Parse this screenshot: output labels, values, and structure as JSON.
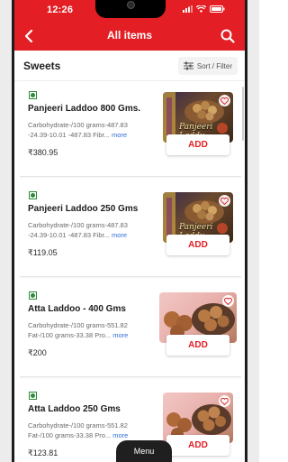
{
  "status": {
    "time": "12:26"
  },
  "appbar": {
    "title": "All items"
  },
  "section": {
    "title": "Sweets",
    "sort_label": "Sort / Filter"
  },
  "products": [
    {
      "name": "Panjeeri Laddoo 800 Gms.",
      "desc": "Carbohydrate-/100 grams-487.83 -24.39-10.01 -487.83 Fibr...",
      "more": "more",
      "price": "₹380.95",
      "add": "ADD",
      "image_text": "Panjeeri Laddu",
      "image": "panjeeri"
    },
    {
      "name": "Panjeeri Laddoo 250 Gms",
      "desc": "Carbohydrate-/100 grams-487.83 -24.39-10.01 -487.83 Fibr...",
      "more": "more",
      "price": "₹119.05",
      "add": "ADD",
      "image_text": "Panjeeri Laddu",
      "image": "panjeeri"
    },
    {
      "name": "Atta Laddoo - 400 Gms",
      "desc": "Carbohydrate-/100 grams-551.82 Fat-/100 grams-33.38 Pro...",
      "more": "more",
      "price": "₹200",
      "add": "ADD",
      "image_text": "",
      "image": "atta"
    },
    {
      "name": "Atta Laddoo 250 Gms",
      "desc": "Carbohydrate-/100 grams-551.82 Fat-/100 grams-33.38 Pro...",
      "more": "more",
      "price": "₹123.81",
      "add": "ADD",
      "image_text": "",
      "image": "atta"
    }
  ],
  "bottom": {
    "menu_label": "Menu"
  },
  "colors": {
    "brand": "#e31e24",
    "veg": "#2e8b3a",
    "link": "#2f6fd6"
  },
  "icons": [
    "back-arrow-icon",
    "search-icon",
    "sort-filter-icon",
    "heart-icon",
    "veg-indicator-icon",
    "wifi-icon",
    "battery-icon",
    "signal-icon"
  ]
}
